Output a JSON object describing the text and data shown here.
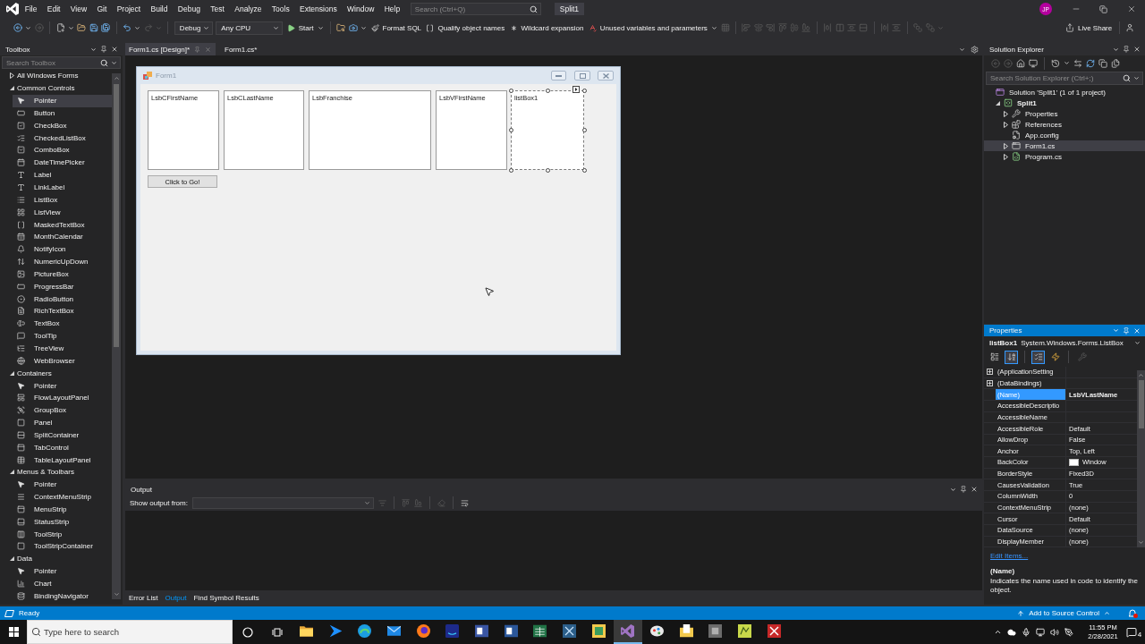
{
  "title_bar": {
    "menu": [
      "File",
      "Edit",
      "View",
      "Git",
      "Project",
      "Build",
      "Debug",
      "Test",
      "Analyze",
      "Tools",
      "Extensions",
      "Window",
      "Help"
    ],
    "search": {
      "placeholder": "Search (Ctrl+Q)"
    },
    "solution_name": "Split1",
    "account": {
      "initials": "JP"
    }
  },
  "toolbar": {
    "navigation": [
      {
        "disabled": false
      },
      {
        "disabled": true
      }
    ],
    "history": [
      {
        "disabled": false
      },
      {
        "disabled": true
      }
    ],
    "configuration": "Debug",
    "platform": "Any CPU",
    "start": "Start",
    "commands": [
      "Format SQL",
      "Qualify object names",
      "Wildcard expansion",
      "Unused variables and parameters"
    ],
    "layout_tools": {
      "disabled": true
    },
    "live_share": "Live Share"
  },
  "toolbox": {
    "title": "Toolbox",
    "active": false,
    "search": {
      "placeholder": "Search Toolbox"
    },
    "groups": [
      {
        "label": "All Windows Forms",
        "expanded": false
      },
      {
        "label": "Common Controls",
        "expanded": true,
        "children": [
          {
            "label": "Pointer",
            "selected": true
          },
          {
            "label": "Button",
            "selected": false
          },
          {
            "label": "CheckBox",
            "selected": false
          },
          {
            "label": "CheckedListBox",
            "selected": false
          },
          {
            "label": "ComboBox",
            "selected": false
          },
          {
            "label": "DateTimePicker",
            "selected": false
          },
          {
            "label": "Label",
            "selected": false
          },
          {
            "label": "LinkLabel",
            "selected": false
          },
          {
            "label": "ListBox",
            "selected": false
          },
          {
            "label": "ListView",
            "selected": false
          },
          {
            "label": "MaskedTextBox",
            "selected": false
          },
          {
            "label": "MonthCalendar",
            "selected": false
          },
          {
            "label": "NotifyIcon",
            "selected": false
          },
          {
            "label": "NumericUpDown",
            "selected": false
          },
          {
            "label": "PictureBox",
            "selected": false
          },
          {
            "label": "ProgressBar",
            "selected": false
          },
          {
            "label": "RadioButton",
            "selected": false
          },
          {
            "label": "RichTextBox",
            "selected": false
          },
          {
            "label": "TextBox",
            "selected": false
          },
          {
            "label": "ToolTip",
            "selected": false
          },
          {
            "label": "TreeView",
            "selected": false
          },
          {
            "label": "WebBrowser",
            "selected": false
          }
        ]
      },
      {
        "label": "Containers",
        "expanded": true,
        "children": [
          {
            "label": "Pointer",
            "selected": false
          },
          {
            "label": "FlowLayoutPanel",
            "selected": false
          },
          {
            "label": "GroupBox",
            "selected": false
          },
          {
            "label": "Panel",
            "selected": false
          },
          {
            "label": "SplitContainer",
            "selected": false
          },
          {
            "label": "TabControl",
            "selected": false
          },
          {
            "label": "TableLayoutPanel",
            "selected": false
          }
        ]
      },
      {
        "label": "Menus & Toolbars",
        "expanded": true,
        "children": [
          {
            "label": "Pointer",
            "selected": false
          },
          {
            "label": "ContextMenuStrip",
            "selected": false
          },
          {
            "label": "MenuStrip",
            "selected": false
          },
          {
            "label": "StatusStrip",
            "selected": false
          },
          {
            "label": "ToolStrip",
            "selected": false
          },
          {
            "label": "ToolStripContainer",
            "selected": false
          }
        ]
      },
      {
        "label": "Data",
        "expanded": true,
        "children": [
          {
            "label": "Pointer",
            "selected": false
          },
          {
            "label": "Chart",
            "selected": false
          },
          {
            "label": "BindingNavigator",
            "selected": false
          }
        ]
      }
    ]
  },
  "document_tabs": [
    {
      "label": "Form1.cs [Design]*",
      "selected": true
    },
    {
      "label": "Form1.cs*",
      "selected": false
    }
  ],
  "designer": {
    "form": {
      "title": "Form1",
      "list_boxes": [
        {
          "text": "LsbCFirstName",
          "selected": false
        },
        {
          "text": "LsbCLastName",
          "selected": false
        },
        {
          "text": "LsbFranchise",
          "selected": false
        },
        {
          "text": "LsbVFirstName",
          "selected": false
        },
        {
          "text": "listBox1",
          "selected": true
        }
      ],
      "button": "Click to Go!"
    }
  },
  "output": {
    "title": "Output",
    "active": false,
    "source_label": "Show output from:",
    "tools": [
      {
        "disabled": true
      },
      {
        "disabled": true
      },
      {
        "disabled": true
      },
      {
        "disabled": true
      },
      {
        "disabled": false
      }
    ],
    "tabs": [
      {
        "label": "Error List",
        "selected": false
      },
      {
        "label": "Output",
        "selected": true
      },
      {
        "label": "Find Symbol Results",
        "selected": false
      }
    ]
  },
  "solution_explorer": {
    "title": "Solution Explorer",
    "active": false,
    "tools": [
      {
        "disabled": true
      },
      {
        "disabled": true
      },
      {
        "disabled": false
      },
      {
        "disabled": false
      },
      {
        "disabled": false
      },
      {
        "disabled": false
      },
      {
        "disabled": false
      },
      {
        "disabled": false
      },
      {
        "disabled": false
      }
    ],
    "search": {
      "placeholder": "Search Solution Explorer (Ctrl+;)"
    },
    "tree": [
      {
        "label": "Solution 'Split1' (1 of 1 project)",
        "kind": "solution",
        "selected": false,
        "children": [
          {
            "label": "Split1",
            "kind": "project",
            "expanded": true,
            "selected": false,
            "children": [
              {
                "label": "Properties",
                "kind": "properties",
                "expanded": false,
                "selected": false
              },
              {
                "label": "References",
                "kind": "references",
                "expanded": false,
                "selected": false
              },
              {
                "label": "App.config",
                "kind": "config",
                "selected": false
              },
              {
                "label": "Form1.cs",
                "kind": "form",
                "expanded": false,
                "selected": true
              },
              {
                "label": "Program.cs",
                "kind": "class",
                "expanded": false,
                "selected": false
              }
            ]
          }
        ]
      }
    ]
  },
  "properties": {
    "title": "Properties",
    "active": true,
    "object": {
      "name": "listBox1",
      "type": "System.Windows.Forms.ListBox"
    },
    "tools": [
      {
        "selected": false,
        "disabled": false
      },
      {
        "selected": true,
        "disabled": false
      },
      {
        "selected": true,
        "disabled": false
      },
      {
        "selected": false,
        "disabled": false
      },
      {
        "selected": false,
        "disabled": true
      }
    ],
    "rows": [
      {
        "name": "(ApplicationSetting",
        "expanded": false,
        "selected": false
      },
      {
        "name": "(DataBindings)",
        "expanded": false,
        "selected": false
      },
      {
        "name": "(Name)",
        "value": "LsbVLastName",
        "selected": true,
        "modified": true
      },
      {
        "name": "AccessibleDescriptio",
        "selected": false
      },
      {
        "name": "AccessibleName",
        "selected": false
      },
      {
        "name": "AccessibleRole",
        "value": "Default",
        "selected": false,
        "modified": false
      },
      {
        "name": "AllowDrop",
        "value": "False",
        "selected": false,
        "modified": false
      },
      {
        "name": "Anchor",
        "value": "Top, Left",
        "selected": false,
        "modified": false
      },
      {
        "name": "BackColor",
        "value": "Window",
        "color": "#ffffff",
        "selected": false,
        "modified": false
      },
      {
        "name": "BorderStyle",
        "value": "Fixed3D",
        "selected": false,
        "modified": false
      },
      {
        "name": "CausesValidation",
        "value": "True",
        "selected": false,
        "modified": false
      },
      {
        "name": "ColumnWidth",
        "value": "0",
        "selected": false,
        "modified": false
      },
      {
        "name": "ContextMenuStrip",
        "value": "(none)",
        "selected": false,
        "modified": false
      },
      {
        "name": "Cursor",
        "value": "Default",
        "selected": false,
        "modified": false
      },
      {
        "name": "DataSource",
        "value": "(none)",
        "selected": false,
        "modified": false
      },
      {
        "name": "DisplayMember",
        "value": "(none)",
        "selected": false,
        "modified": false
      }
    ],
    "edit_link": "Edit Items...",
    "description": {
      "title": "(Name)",
      "text": "Indicates the name used in code to identify the object."
    }
  },
  "status_bar": {
    "text": "Ready",
    "source_control": "Add to Source Control"
  },
  "taskbar": {
    "search": {
      "placeholder": "Type here to search"
    },
    "apps": [
      {
        "selected": false
      },
      {
        "selected": false
      },
      {
        "selected": false
      },
      {
        "selected": false
      },
      {
        "selected": false
      },
      {
        "selected": false
      },
      {
        "selected": false
      },
      {
        "selected": false
      },
      {
        "selected": false
      },
      {
        "selected": false
      },
      {
        "selected": false
      },
      {
        "selected": true
      },
      {
        "selected": false
      },
      {
        "selected": false
      },
      {
        "selected": false
      },
      {
        "selected": false
      },
      {
        "selected": false
      }
    ],
    "clock": {
      "time": "11:55 PM",
      "date": "2/28/2021"
    },
    "notification_count": "4"
  }
}
